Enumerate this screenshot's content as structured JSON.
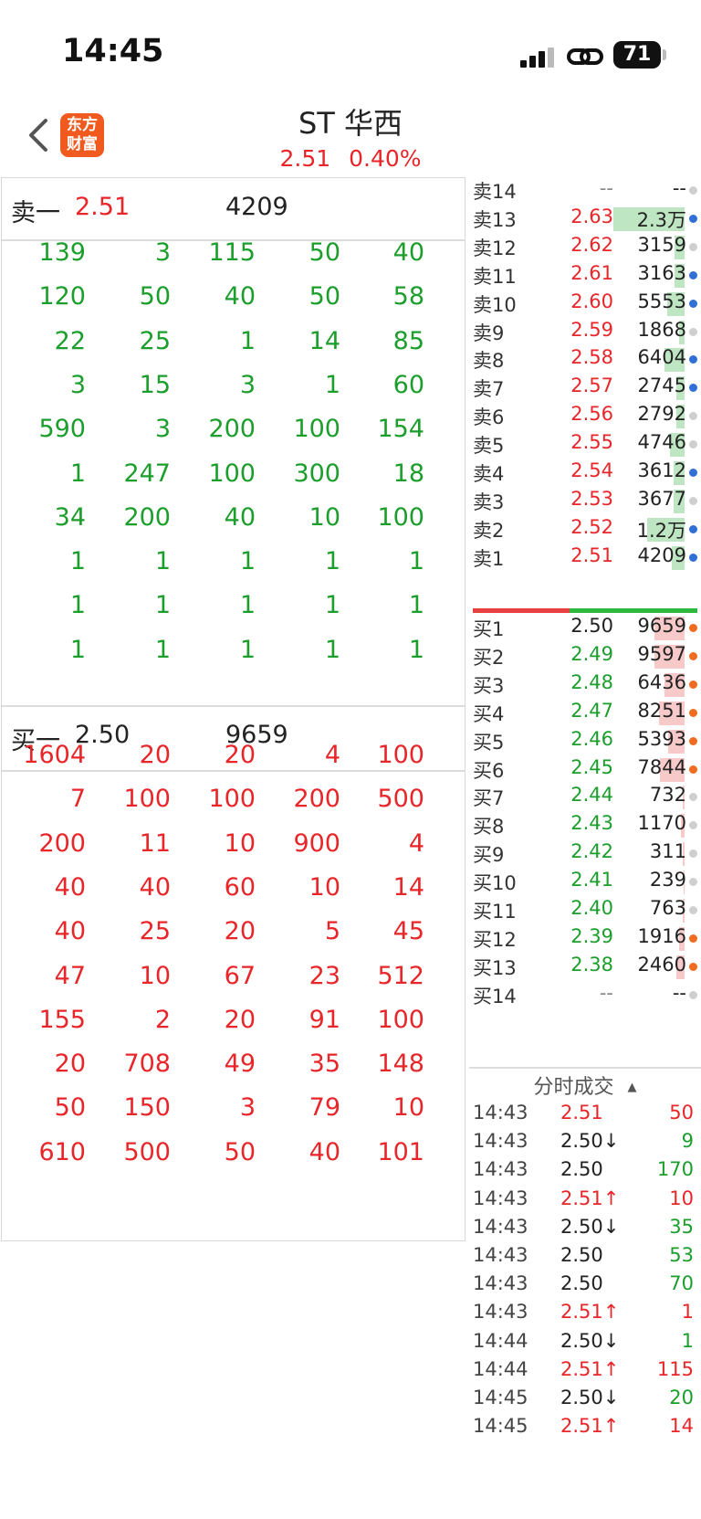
{
  "status_bar": {
    "time": "14:45",
    "battery": "71"
  },
  "header": {
    "logo_line1": "东方",
    "logo_line2": "财富",
    "title": "ST 华西",
    "price": "2.51",
    "change_pct": "0.40%"
  },
  "ask_summary": {
    "label": "卖一",
    "price": "2.51",
    "volume": "4209"
  },
  "ask_queue": [
    [
      "139",
      "3",
      "115",
      "50",
      "40"
    ],
    [
      "120",
      "50",
      "40",
      "50",
      "58"
    ],
    [
      "22",
      "25",
      "1",
      "14",
      "85"
    ],
    [
      "3",
      "15",
      "3",
      "1",
      "60"
    ],
    [
      "590",
      "3",
      "200",
      "100",
      "154"
    ],
    [
      "1",
      "247",
      "100",
      "300",
      "18"
    ],
    [
      "34",
      "200",
      "40",
      "10",
      "100"
    ],
    [
      "1",
      "1",
      "1",
      "1",
      "1"
    ],
    [
      "1",
      "1",
      "1",
      "1",
      "1"
    ],
    [
      "1",
      "1",
      "1",
      "1",
      "1"
    ]
  ],
  "bid_summary": {
    "label": "买一",
    "price": "2.50",
    "volume": "9659"
  },
  "bid_queue": [
    [
      "1604",
      "20",
      "20",
      "4",
      "100"
    ],
    [
      "7",
      "100",
      "100",
      "200",
      "500"
    ],
    [
      "200",
      "11",
      "10",
      "900",
      "4"
    ],
    [
      "40",
      "40",
      "60",
      "10",
      "14"
    ],
    [
      "40",
      "25",
      "20",
      "5",
      "45"
    ],
    [
      "47",
      "10",
      "67",
      "23",
      "512"
    ],
    [
      "155",
      "2",
      "20",
      "91",
      "100"
    ],
    [
      "20",
      "708",
      "49",
      "35",
      "148"
    ],
    [
      "50",
      "150",
      "3",
      "79",
      "10"
    ],
    [
      "610",
      "500",
      "50",
      "40",
      "101"
    ]
  ],
  "asks": [
    {
      "label": "卖14",
      "price": "--",
      "volume": "--",
      "bar": 0,
      "dot": "#cfcfcf",
      "price_color": "#888"
    },
    {
      "label": "卖13",
      "price": "2.63",
      "volume": "2.3万",
      "bar": 1.0,
      "dot": "#2f6fd6",
      "price_color": "#e8262a"
    },
    {
      "label": "卖12",
      "price": "2.62",
      "volume": "3159",
      "bar": 0.14,
      "dot": "#cfcfcf",
      "price_color": "#e8262a"
    },
    {
      "label": "卖11",
      "price": "2.61",
      "volume": "3163",
      "bar": 0.14,
      "dot": "#2f6fd6",
      "price_color": "#e8262a"
    },
    {
      "label": "卖10",
      "price": "2.60",
      "volume": "5553",
      "bar": 0.24,
      "dot": "#2f6fd6",
      "price_color": "#e8262a"
    },
    {
      "label": "卖9",
      "price": "2.59",
      "volume": "1868",
      "bar": 0.08,
      "dot": "#cfcfcf",
      "price_color": "#e8262a"
    },
    {
      "label": "卖8",
      "price": "2.58",
      "volume": "6404",
      "bar": 0.28,
      "dot": "#2f6fd6",
      "price_color": "#e8262a"
    },
    {
      "label": "卖7",
      "price": "2.57",
      "volume": "2745",
      "bar": 0.12,
      "dot": "#2f6fd6",
      "price_color": "#e8262a"
    },
    {
      "label": "卖6",
      "price": "2.56",
      "volume": "2792",
      "bar": 0.12,
      "dot": "#cfcfcf",
      "price_color": "#e8262a"
    },
    {
      "label": "卖5",
      "price": "2.55",
      "volume": "4746",
      "bar": 0.21,
      "dot": "#cfcfcf",
      "price_color": "#e8262a"
    },
    {
      "label": "卖4",
      "price": "2.54",
      "volume": "3612",
      "bar": 0.16,
      "dot": "#2f6fd6",
      "price_color": "#e8262a"
    },
    {
      "label": "卖3",
      "price": "2.53",
      "volume": "3677",
      "bar": 0.16,
      "dot": "#cfcfcf",
      "price_color": "#e8262a"
    },
    {
      "label": "卖2",
      "price": "2.52",
      "volume": "1.2万",
      "bar": 0.52,
      "dot": "#2f6fd6",
      "price_color": "#e8262a"
    },
    {
      "label": "卖1",
      "price": "2.51",
      "volume": "4209",
      "bar": 0.18,
      "dot": "#2f6fd6",
      "price_color": "#e8262a"
    }
  ],
  "bids": [
    {
      "label": "买1",
      "price": "2.50",
      "volume": "9659",
      "bar": 0.42,
      "dot": "#f06a20",
      "price_color": "#222"
    },
    {
      "label": "买2",
      "price": "2.49",
      "volume": "9597",
      "bar": 0.42,
      "dot": "#f06a20",
      "price_color": "#1c9e2c"
    },
    {
      "label": "买3",
      "price": "2.48",
      "volume": "6436",
      "bar": 0.28,
      "dot": "#f06a20",
      "price_color": "#1c9e2c"
    },
    {
      "label": "买4",
      "price": "2.47",
      "volume": "8251",
      "bar": 0.36,
      "dot": "#f06a20",
      "price_color": "#1c9e2c"
    },
    {
      "label": "买5",
      "price": "2.46",
      "volume": "5393",
      "bar": 0.23,
      "dot": "#f06a20",
      "price_color": "#1c9e2c"
    },
    {
      "label": "买6",
      "price": "2.45",
      "volume": "7844",
      "bar": 0.34,
      "dot": "#f06a20",
      "price_color": "#1c9e2c"
    },
    {
      "label": "买7",
      "price": "2.44",
      "volume": "732",
      "bar": 0.03,
      "dot": "#cfcfcf",
      "price_color": "#1c9e2c"
    },
    {
      "label": "买8",
      "price": "2.43",
      "volume": "1170",
      "bar": 0.05,
      "dot": "#cfcfcf",
      "price_color": "#1c9e2c"
    },
    {
      "label": "买9",
      "price": "2.42",
      "volume": "311",
      "bar": 0.02,
      "dot": "#cfcfcf",
      "price_color": "#1c9e2c"
    },
    {
      "label": "买10",
      "price": "2.41",
      "volume": "239",
      "bar": 0.01,
      "dot": "#cfcfcf",
      "price_color": "#1c9e2c"
    },
    {
      "label": "买11",
      "price": "2.40",
      "volume": "763",
      "bar": 0.03,
      "dot": "#cfcfcf",
      "price_color": "#1c9e2c"
    },
    {
      "label": "买12",
      "price": "2.39",
      "volume": "1916",
      "bar": 0.08,
      "dot": "#f06a20",
      "price_color": "#1c9e2c"
    },
    {
      "label": "买13",
      "price": "2.38",
      "volume": "2460",
      "bar": 0.11,
      "dot": "#f06a20",
      "price_color": "#1c9e2c"
    },
    {
      "label": "买14",
      "price": "--",
      "volume": "--",
      "bar": 0,
      "dot": "#cfcfcf",
      "price_color": "#888"
    }
  ],
  "buy_sell_ratio": 0.43,
  "ticks_title": "分时成交",
  "ticks": [
    {
      "time": "14:43",
      "price": "2.51",
      "arrow": "",
      "volume": "50",
      "price_color": "#e8262a",
      "vol_color": "#e8262a"
    },
    {
      "time": "14:43",
      "price": "2.50",
      "arrow": "↓",
      "volume": "9",
      "price_color": "#222",
      "vol_color": "#1c9e2c"
    },
    {
      "time": "14:43",
      "price": "2.50",
      "arrow": "",
      "volume": "170",
      "price_color": "#222",
      "vol_color": "#1c9e2c"
    },
    {
      "time": "14:43",
      "price": "2.51",
      "arrow": "↑",
      "volume": "10",
      "price_color": "#e8262a",
      "vol_color": "#e8262a"
    },
    {
      "time": "14:43",
      "price": "2.50",
      "arrow": "↓",
      "volume": "35",
      "price_color": "#222",
      "vol_color": "#1c9e2c"
    },
    {
      "time": "14:43",
      "price": "2.50",
      "arrow": "",
      "volume": "53",
      "price_color": "#222",
      "vol_color": "#1c9e2c"
    },
    {
      "time": "14:43",
      "price": "2.50",
      "arrow": "",
      "volume": "70",
      "price_color": "#222",
      "vol_color": "#1c9e2c"
    },
    {
      "time": "14:43",
      "price": "2.51",
      "arrow": "↑",
      "volume": "1",
      "price_color": "#e8262a",
      "vol_color": "#e8262a"
    },
    {
      "time": "14:44",
      "price": "2.50",
      "arrow": "↓",
      "volume": "1",
      "price_color": "#222",
      "vol_color": "#1c9e2c"
    },
    {
      "time": "14:44",
      "price": "2.51",
      "arrow": "↑",
      "volume": "115",
      "price_color": "#e8262a",
      "vol_color": "#e8262a"
    },
    {
      "time": "14:45",
      "price": "2.50",
      "arrow": "↓",
      "volume": "20",
      "price_color": "#222",
      "vol_color": "#1c9e2c"
    },
    {
      "time": "14:45",
      "price": "2.51",
      "arrow": "↑",
      "volume": "14",
      "price_color": "#e8262a",
      "vol_color": "#e8262a"
    }
  ],
  "colors": {
    "up": "#e8262a",
    "down": "#1c9e2c",
    "ask_bar": "#bfe6c2",
    "bid_bar": "#f7c9c9"
  }
}
